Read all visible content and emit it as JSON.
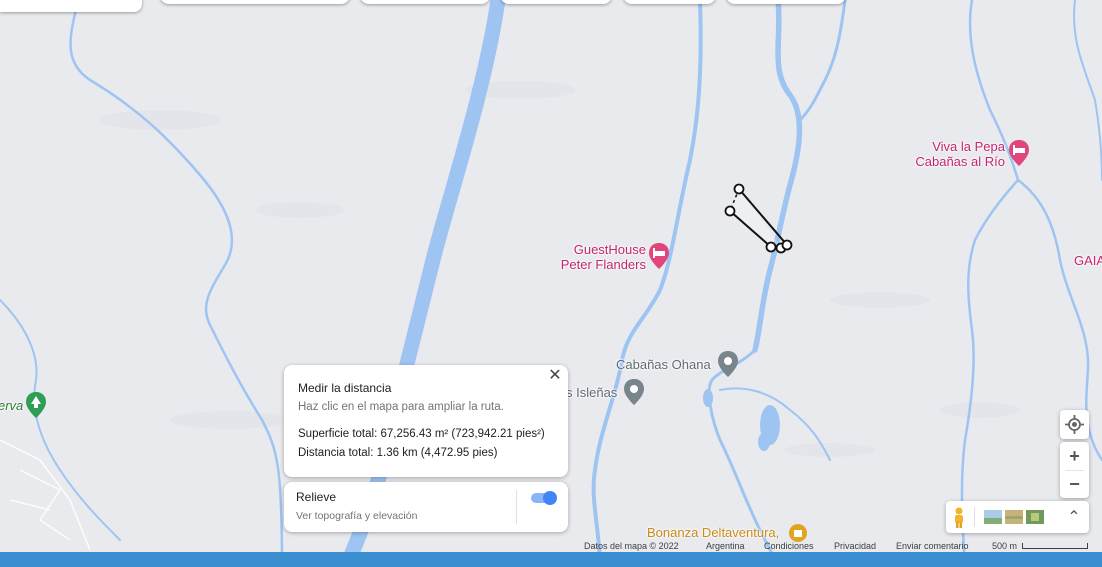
{
  "labels": {
    "viva_la_pepa": [
      "Viva la Pepa",
      "Cabañas al Río"
    ],
    "guesthouse": [
      "GuestHouse",
      "Peter Flanders"
    ],
    "cabanas_ohana": "Cabañas Ohana",
    "islenas": "s Isleñas",
    "reserva": "erva",
    "gaia": "GAIA",
    "bonanza": "Bonanza Deltaventura,"
  },
  "measure_panel": {
    "title": "Medir la distancia",
    "subtitle": "Haz clic en el mapa para ampliar la ruta.",
    "area": "Superficie total: 67,256.43 m² (723,942.21 pies²)",
    "distance": "Distancia total: 1.36 km (4,472.95 pies)",
    "close_glyph": "✕"
  },
  "relief_toggle": {
    "title": "Relieve",
    "subtitle": "Ver topografía y elevación",
    "enabled": true
  },
  "attribution": {
    "data": "Datos del mapa © 2022",
    "country": "Argentina",
    "terms": "Condiciones",
    "privacy": "Privacidad",
    "feedback": "Enviar comentario",
    "scale": "500 m"
  },
  "controls": {
    "zoom_in": "+",
    "zoom_out": "−",
    "expand_glyph": "⌃"
  },
  "colors": {
    "water": "#9ec4f2",
    "background": "#e9eaee",
    "lodging": "#c5246f",
    "toggle": "#4285f4"
  },
  "icons": [
    "bed-icon",
    "location-pin-icon",
    "tree-icon",
    "my-location-icon",
    "pegman-icon",
    "layers-thumbnail-icon",
    "expand-icon",
    "close-icon"
  ]
}
